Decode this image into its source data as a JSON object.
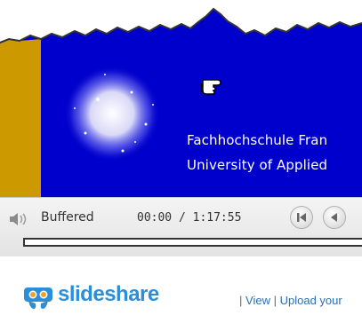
{
  "slide": {
    "line1": "Fachhochschule Fran",
    "line2": "University of Applied"
  },
  "player": {
    "status": "Buffered",
    "current_time": "00:00",
    "total_time": "1:17:55",
    "time_separator": " / ",
    "progress": 0
  },
  "footer": {
    "brand": "slideshare",
    "separator": "|",
    "view_label": "View",
    "upload_label": "Upload your"
  },
  "colors": {
    "slide_background": "#0000cc",
    "accent_bar": "#cc9900",
    "brand": "#2b8ed8"
  },
  "icons": {
    "volume": "speaker-icon",
    "first": "skip-first-icon",
    "prev": "previous-icon",
    "cursor": "pointing-hand-icon",
    "logo": "slideshare-logo-icon"
  }
}
